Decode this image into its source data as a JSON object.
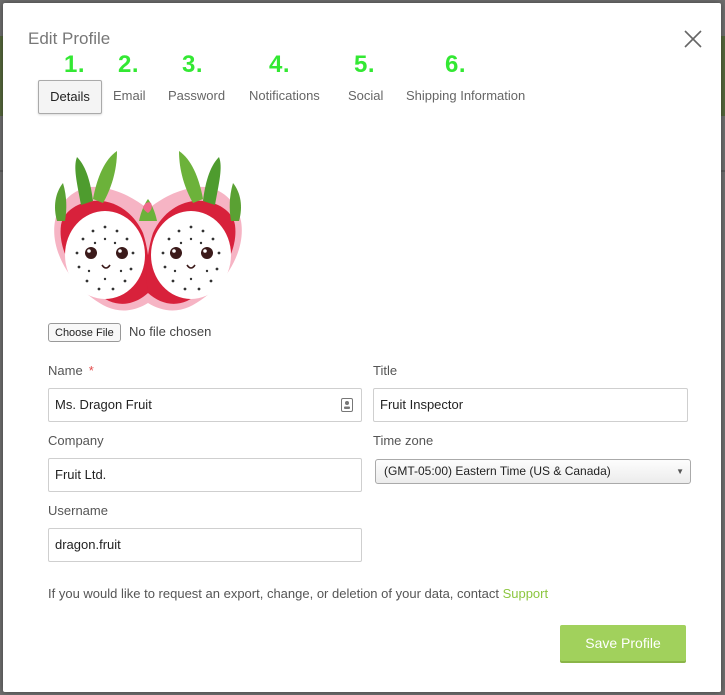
{
  "modal": {
    "title": "Edit Profile"
  },
  "tabs": [
    {
      "step": "1.",
      "label": "Details"
    },
    {
      "step": "2.",
      "label": "Email"
    },
    {
      "step": "3.",
      "label": "Password"
    },
    {
      "step": "4.",
      "label": "Notifications"
    },
    {
      "step": "5.",
      "label": "Social"
    },
    {
      "step": "6.",
      "label": "Shipping Information"
    }
  ],
  "avatar": {
    "icon": "dragon-fruit-avatar"
  },
  "file_upload": {
    "button_label": "Choose File",
    "status": "No file chosen"
  },
  "form": {
    "name": {
      "label": "Name",
      "required_mark": "*",
      "value": "Ms. Dragon Fruit"
    },
    "title": {
      "label": "Title",
      "value": "Fruit Inspector"
    },
    "company": {
      "label": "Company",
      "value": "Fruit Ltd."
    },
    "timezone": {
      "label": "Time zone",
      "value": "(GMT-05:00) Eastern Time (US & Canada)"
    },
    "username": {
      "label": "Username",
      "value": "dragon.fruit"
    }
  },
  "notice": {
    "text": "If you would like to request an export, change, or deletion of your data, contact ",
    "link": "Support"
  },
  "save_label": "Save Profile",
  "colors": {
    "accent": "#a1d15c",
    "link": "#8cc63f",
    "step_numbers": "#33e833",
    "required": "#e34b4b"
  }
}
